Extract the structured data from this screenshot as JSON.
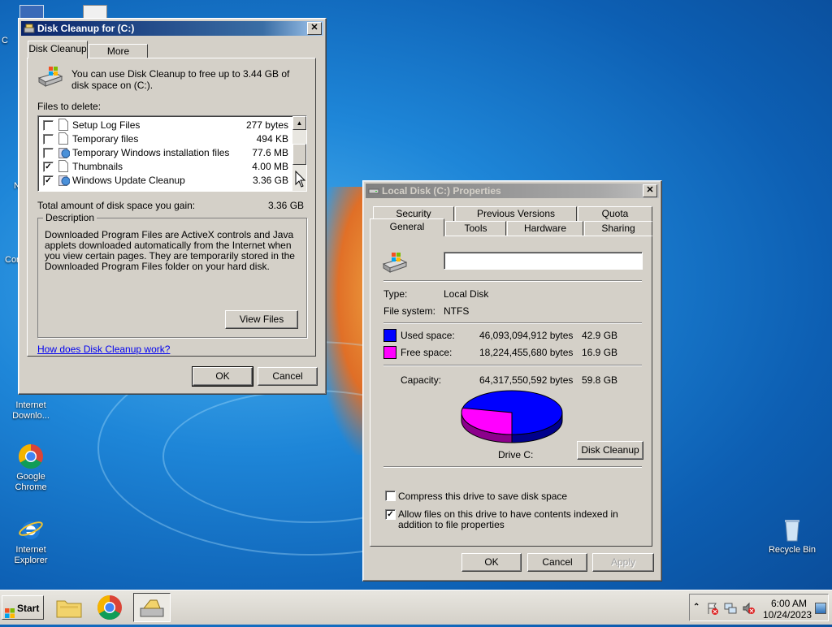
{
  "desktop": {
    "icons": [
      {
        "label": "Internet\nDownlo..."
      },
      {
        "label": "Google Chrome"
      },
      {
        "label": "Internet\nExplorer"
      },
      {
        "label": "Recycle Bin"
      }
    ],
    "partial_labels": [
      "C",
      "N",
      "Con"
    ]
  },
  "cleanup": {
    "title": "Disk Cleanup for  (C:)",
    "tabs": [
      "Disk Cleanup",
      "More Options"
    ],
    "intro": "You can use Disk Cleanup to free up to 3.44 GB of disk space on  (C:).",
    "files_label": "Files to delete:",
    "files": [
      {
        "name": "Setup Log Files",
        "size": "277 bytes",
        "checked": false
      },
      {
        "name": "Temporary files",
        "size": "494 KB",
        "checked": false
      },
      {
        "name": "Temporary Windows installation files",
        "size": "77.6 MB",
        "checked": false
      },
      {
        "name": "Thumbnails",
        "size": "4.00 MB",
        "checked": true
      },
      {
        "name": "Windows Update Cleanup",
        "size": "3.36 GB",
        "checked": true
      }
    ],
    "total_label": "Total amount of disk space you gain:",
    "total_value": "3.36 GB",
    "description_label": "Description",
    "description": "Downloaded Program Files are ActiveX controls and Java applets downloaded automatically from the Internet when you view certain pages. They are temporarily stored in the Downloaded Program Files folder on your hard disk.",
    "view_files": "View Files",
    "help_link": "How does Disk Cleanup work?",
    "ok": "OK",
    "cancel": "Cancel"
  },
  "props": {
    "title": "Local Disk (C:) Properties",
    "tabs_top": [
      "Security",
      "Previous Versions",
      "Quota"
    ],
    "tabs_bottom": [
      "General",
      "Tools",
      "Hardware",
      "Sharing"
    ],
    "name_value": "",
    "type_label": "Type:",
    "type_value": "Local Disk",
    "fs_label": "File system:",
    "fs_value": "NTFS",
    "used_label": "Used space:",
    "used_bytes": "46,093,094,912 bytes",
    "used_gb": "42.9 GB",
    "free_label": "Free space:",
    "free_bytes": "18,224,455,680 bytes",
    "free_gb": "16.9 GB",
    "capacity_label": "Capacity:",
    "capacity_bytes": "64,317,550,592 bytes",
    "capacity_gb": "59.8 GB",
    "used_fraction": 0.7166,
    "used_color": "#0000ff",
    "free_color": "#ff00ff",
    "drive_label": "Drive C:",
    "disk_cleanup": "Disk Cleanup",
    "compress_label": "Compress this drive to save disk space",
    "compress_checked": false,
    "index_label": "Allow files on this drive to have contents indexed in addition to file properties",
    "index_checked": true,
    "ok": "OK",
    "cancel": "Cancel",
    "apply": "Apply"
  },
  "taskbar": {
    "start": "Start",
    "time": "6:00 AM",
    "date": "10/24/2023"
  }
}
